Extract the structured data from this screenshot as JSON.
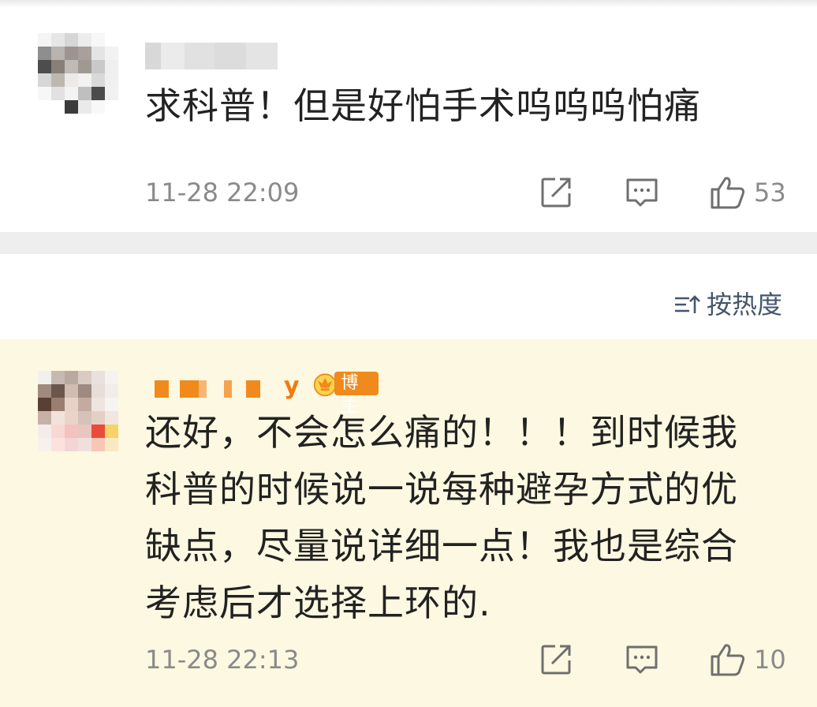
{
  "comments": [
    {
      "text": "求科普！但是好怕手术呜呜呜怕痛",
      "time": "11-28 22:09",
      "likes": "53"
    },
    {
      "username_suffix": "y",
      "badge": "博主",
      "lines": [
        "还好，不会怎么痛的！！！到时候我",
        "科普的时候说一说每种避孕方式的优",
        "缺点，尽量说详细一点！我也是综合",
        "考虑后才选择上环的."
      ],
      "time": "11-28 22:13",
      "likes": "10"
    }
  ],
  "sort": {
    "label": "按热度"
  },
  "icons": {
    "share": "share-icon",
    "comment": "comment-icon",
    "like": "thumbs-up-icon",
    "sort": "sort-icon",
    "crown": "crown-icon"
  },
  "colors": {
    "highlight_background": "#fdf8e1",
    "badge": "#f08a1c",
    "meta_text": "#8a8a8a",
    "sort_text": "#45556c"
  }
}
